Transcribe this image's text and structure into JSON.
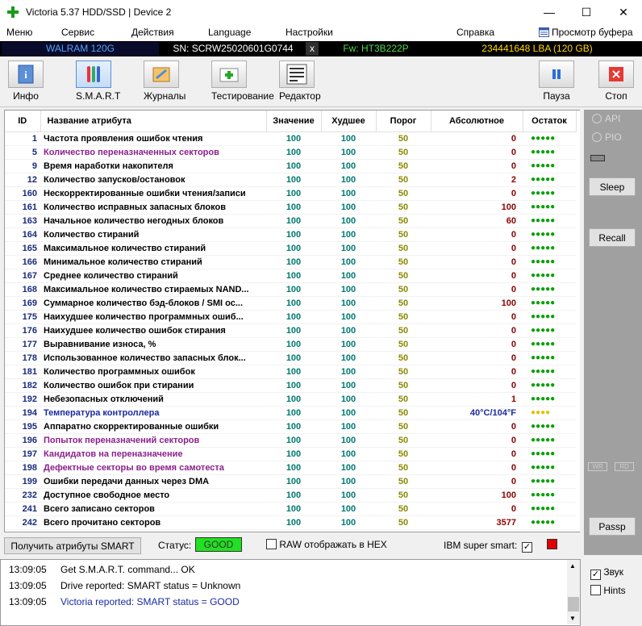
{
  "window": {
    "title": "Victoria 5.37 HDD/SSD | Device 2",
    "minimize": "—",
    "maximize": "☐",
    "close": "✕"
  },
  "menu": {
    "items": [
      "Меню",
      "Сервис",
      "Действия",
      "Language",
      "Настройки",
      "Справка"
    ],
    "buffer_view": "Просмотр буфера"
  },
  "drive": {
    "model": "WALRAM 120G",
    "serial": "SN: SCRW25020601G0744",
    "close_x": "x",
    "firmware": "Fw: HT3B222P",
    "lba": "234441648 LBA (120 GB)"
  },
  "toolbar": {
    "info": "Инфо",
    "smart": "S.M.A.R.T",
    "logs": "Журналы",
    "testing": "Тестирование",
    "editor": "Редактор",
    "editor_icon_text": "010110\n110011\n101000\n0001",
    "pause": "Пауза",
    "stop": "Стоп"
  },
  "table": {
    "headers": [
      "ID",
      "Название атрибута",
      "Значение",
      "Худшее",
      "Порог",
      "Абсолютное",
      "Остаток"
    ],
    "rows": [
      {
        "id": "1",
        "name": "Частота проявления ошибок чтения",
        "val": "100",
        "worst": "100",
        "thr": "50",
        "abs": "0",
        "rem": "●●●●●",
        "style": ""
      },
      {
        "id": "5",
        "name": "Количество переназначенных секторов",
        "val": "100",
        "worst": "100",
        "thr": "50",
        "abs": "0",
        "rem": "●●●●●",
        "style": "purple"
      },
      {
        "id": "9",
        "name": "Время наработки накопителя",
        "val": "100",
        "worst": "100",
        "thr": "50",
        "abs": "0",
        "rem": "●●●●●",
        "style": ""
      },
      {
        "id": "12",
        "name": "Количество запусков/остановок",
        "val": "100",
        "worst": "100",
        "thr": "50",
        "abs": "2",
        "rem": "●●●●●",
        "style": ""
      },
      {
        "id": "160",
        "name": "Нескорректированные ошибки чтения/записи",
        "val": "100",
        "worst": "100",
        "thr": "50",
        "abs": "0",
        "rem": "●●●●●",
        "style": ""
      },
      {
        "id": "161",
        "name": "Количество исправных запасных блоков",
        "val": "100",
        "worst": "100",
        "thr": "50",
        "abs": "100",
        "rem": "●●●●●",
        "style": ""
      },
      {
        "id": "163",
        "name": "Начальное количество негодных блоков",
        "val": "100",
        "worst": "100",
        "thr": "50",
        "abs": "60",
        "rem": "●●●●●",
        "style": ""
      },
      {
        "id": "164",
        "name": "Количество стираний",
        "val": "100",
        "worst": "100",
        "thr": "50",
        "abs": "0",
        "rem": "●●●●●",
        "style": ""
      },
      {
        "id": "165",
        "name": "Максимальное количество стираний",
        "val": "100",
        "worst": "100",
        "thr": "50",
        "abs": "0",
        "rem": "●●●●●",
        "style": ""
      },
      {
        "id": "166",
        "name": "Минимальное количество стираний",
        "val": "100",
        "worst": "100",
        "thr": "50",
        "abs": "0",
        "rem": "●●●●●",
        "style": ""
      },
      {
        "id": "167",
        "name": "Среднее количество стираний",
        "val": "100",
        "worst": "100",
        "thr": "50",
        "abs": "0",
        "rem": "●●●●●",
        "style": ""
      },
      {
        "id": "168",
        "name": "Максимальное количество стираемых NAND...",
        "val": "100",
        "worst": "100",
        "thr": "50",
        "abs": "0",
        "rem": "●●●●●",
        "style": ""
      },
      {
        "id": "169",
        "name": "Суммарное количество бэд-блоков / SMI ос...",
        "val": "100",
        "worst": "100",
        "thr": "50",
        "abs": "100",
        "rem": "●●●●●",
        "style": ""
      },
      {
        "id": "175",
        "name": "Наихудшее количество программных ошиб...",
        "val": "100",
        "worst": "100",
        "thr": "50",
        "abs": "0",
        "rem": "●●●●●",
        "style": ""
      },
      {
        "id": "176",
        "name": "Наихудшее количество ошибок стирания",
        "val": "100",
        "worst": "100",
        "thr": "50",
        "abs": "0",
        "rem": "●●●●●",
        "style": ""
      },
      {
        "id": "177",
        "name": "Выравнивание износа, %",
        "val": "100",
        "worst": "100",
        "thr": "50",
        "abs": "0",
        "rem": "●●●●●",
        "style": ""
      },
      {
        "id": "178",
        "name": "Использованное количество запасных блок...",
        "val": "100",
        "worst": "100",
        "thr": "50",
        "abs": "0",
        "rem": "●●●●●",
        "style": ""
      },
      {
        "id": "181",
        "name": "Количество программных ошибок",
        "val": "100",
        "worst": "100",
        "thr": "50",
        "abs": "0",
        "rem": "●●●●●",
        "style": ""
      },
      {
        "id": "182",
        "name": "Количество ошибок при стирании",
        "val": "100",
        "worst": "100",
        "thr": "50",
        "abs": "0",
        "rem": "●●●●●",
        "style": ""
      },
      {
        "id": "192",
        "name": "Небезопасных отключений",
        "val": "100",
        "worst": "100",
        "thr": "50",
        "abs": "1",
        "rem": "●●●●●",
        "style": ""
      },
      {
        "id": "194",
        "name": "Температура контроллера",
        "val": "100",
        "worst": "100",
        "thr": "50",
        "abs": "40°C/104°F",
        "rem": "●●●●",
        "style": "blue"
      },
      {
        "id": "195",
        "name": "Аппаратно скорректированные ошибки",
        "val": "100",
        "worst": "100",
        "thr": "50",
        "abs": "0",
        "rem": "●●●●●",
        "style": ""
      },
      {
        "id": "196",
        "name": "Попыток переназначений секторов",
        "val": "100",
        "worst": "100",
        "thr": "50",
        "abs": "0",
        "rem": "●●●●●",
        "style": "purple"
      },
      {
        "id": "197",
        "name": "Кандидатов на переназначение",
        "val": "100",
        "worst": "100",
        "thr": "50",
        "abs": "0",
        "rem": "●●●●●",
        "style": "purple"
      },
      {
        "id": "198",
        "name": "Дефектные секторы во время самотеста",
        "val": "100",
        "worst": "100",
        "thr": "50",
        "abs": "0",
        "rem": "●●●●●",
        "style": "purple"
      },
      {
        "id": "199",
        "name": "Ошибки передачи данных через DMA",
        "val": "100",
        "worst": "100",
        "thr": "50",
        "abs": "0",
        "rem": "●●●●●",
        "style": ""
      },
      {
        "id": "232",
        "name": "Доступное свободное место",
        "val": "100",
        "worst": "100",
        "thr": "50",
        "abs": "100",
        "rem": "●●●●●",
        "style": ""
      },
      {
        "id": "241",
        "name": "Всего записано секторов",
        "val": "100",
        "worst": "100",
        "thr": "50",
        "abs": "0",
        "rem": "●●●●●",
        "style": ""
      },
      {
        "id": "242",
        "name": "Всего прочитано секторов",
        "val": "100",
        "worst": "100",
        "thr": "50",
        "abs": "3577",
        "rem": "●●●●●",
        "style": ""
      }
    ]
  },
  "side": {
    "api": "API",
    "pio": "PIO",
    "sleep": "Sleep",
    "recall": "Recall",
    "wr": "WR",
    "rd": "RD",
    "passp": "Passp",
    "sound": "Звук",
    "hints": "Hints"
  },
  "status_bar": {
    "get_smart": "Получить атрибуты SMART",
    "status_label": "Статус:",
    "status_value": "GOOD",
    "raw_hex": "RAW отображать в HEX",
    "ibm_label": "IBM super smart:",
    "check_mark": "✓"
  },
  "log": [
    {
      "time": "13:09:05",
      "text": "Get S.M.A.R.T. command... OK",
      "color": "#000000"
    },
    {
      "time": "13:09:05",
      "text": "Drive reported: SMART status = Unknown",
      "color": "#000000"
    },
    {
      "time": "13:09:05",
      "text": "Victoria reported: SMART status = GOOD",
      "color": "#1a2aa0"
    }
  ],
  "colors": {
    "status_good": "#22e022",
    "ibm_indicator": "#e00000",
    "stop_red": "#e53935"
  }
}
